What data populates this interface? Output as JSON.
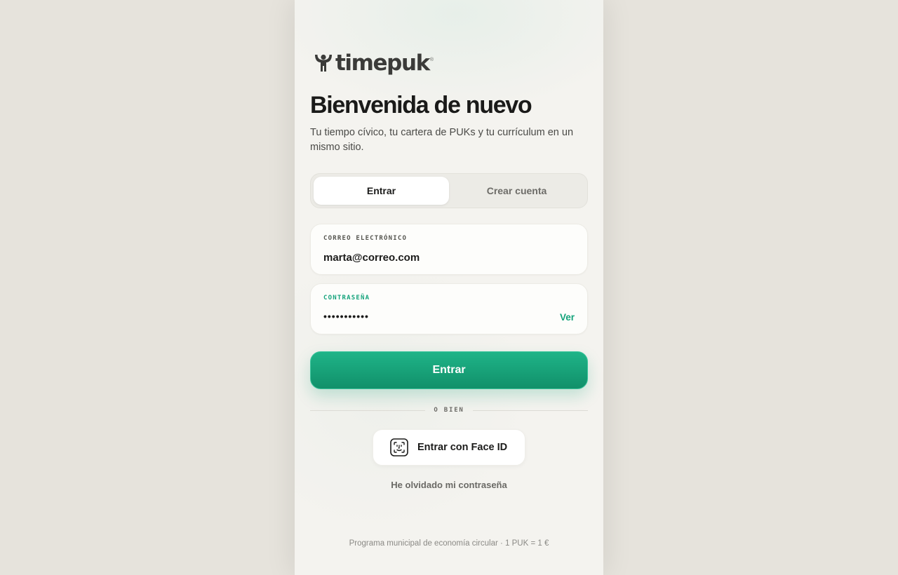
{
  "brand": {
    "name": "timepuk",
    "registered": "®",
    "logo_icon": "person-arms-up-icon"
  },
  "header": {
    "title": "Bienvenida de nuevo",
    "subtitle": "Tu tiempo cívico, tu cartera de PUKs y tu currículum en un mismo sitio."
  },
  "tabs": [
    {
      "label": "Entrar",
      "active": true
    },
    {
      "label": "Crear cuenta",
      "active": false
    }
  ],
  "form": {
    "email": {
      "label": "CORREO ELECTRÓNICO",
      "value": "marta@correo.com"
    },
    "password": {
      "label": "CONTRASEÑA",
      "value": "marta2024pw",
      "toggle_label": "Ver"
    },
    "submit_label": "Entrar"
  },
  "divider": "O BIEN",
  "faceid": {
    "label": "Entrar con Face ID",
    "icon": "face-id-icon"
  },
  "forgot_label": "He olvidado mi contraseña",
  "footer": "Programa municipal de economía circular · 1 PUK = 1 €",
  "colors": {
    "accent": "#14a37b",
    "background": "#e6e3dc",
    "panel": "#f4f3ef"
  }
}
